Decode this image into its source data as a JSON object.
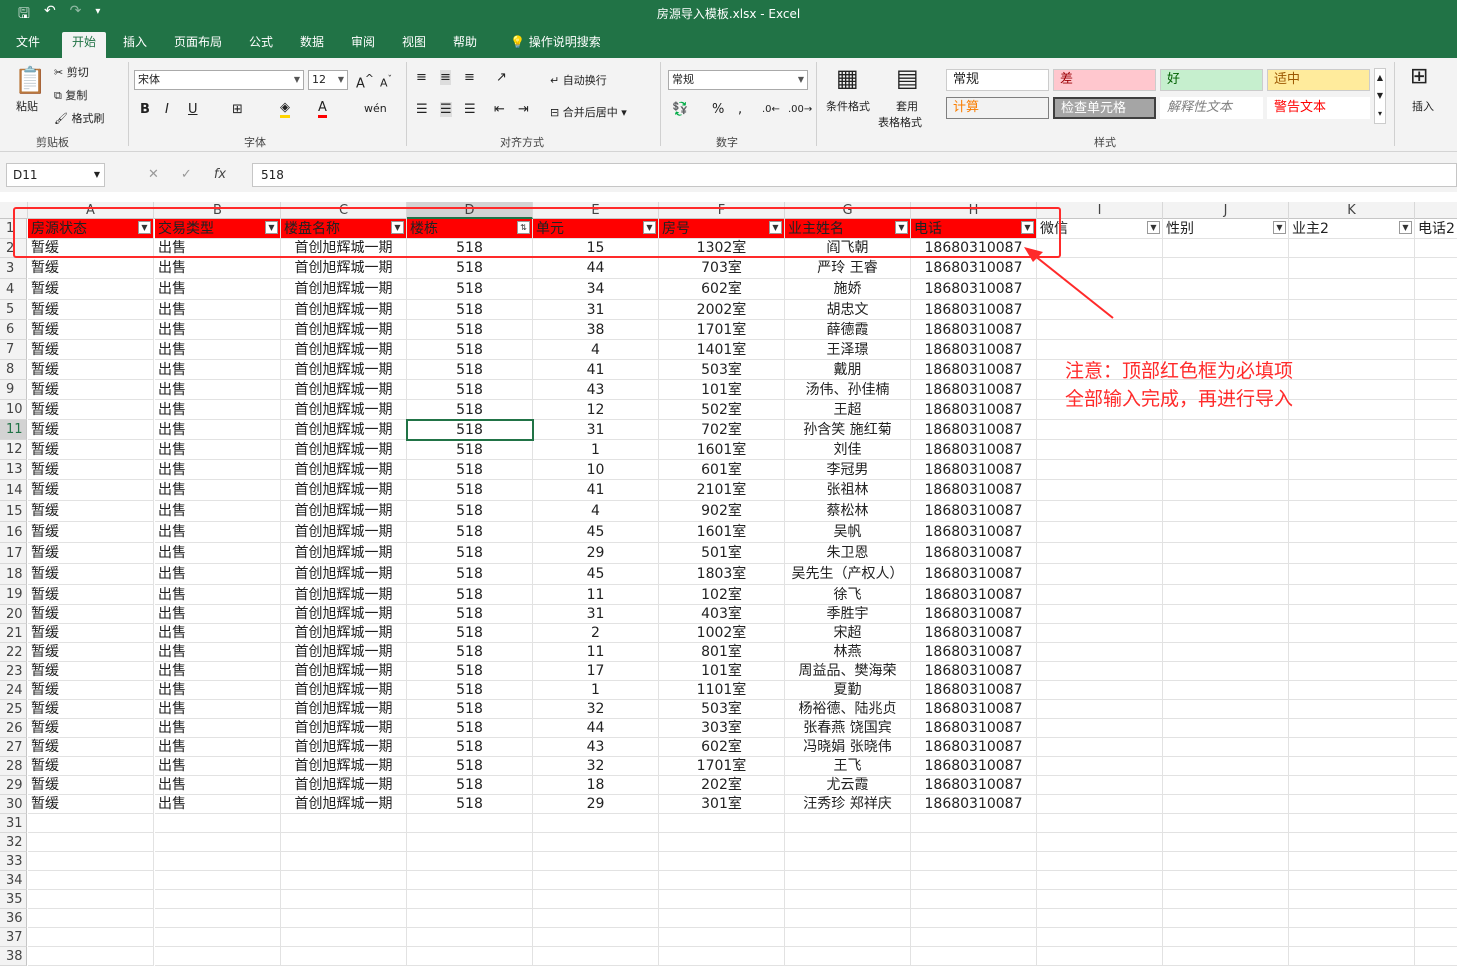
{
  "titlebar": {
    "title": "房源导入模板.xlsx  -  Excel"
  },
  "tabs": [
    "文件",
    "开始",
    "插入",
    "页面布局",
    "公式",
    "数据",
    "审阅",
    "视图",
    "帮助",
    "操作说明搜索"
  ],
  "ribbon": {
    "clipboard": {
      "paste": "粘贴",
      "cut": "剪切",
      "copy": "复制",
      "format_painter": "格式刷",
      "label": "剪贴板"
    },
    "font": {
      "name": "宋体",
      "size": "12",
      "label": "字体"
    },
    "alignment": {
      "wrap": "自动换行",
      "merge": "合并后居中",
      "label": "对齐方式"
    },
    "number": {
      "format": "常规",
      "label": "数字"
    },
    "styles": {
      "cond": "条件格式",
      "table1": "套用",
      "table2": "表格格式",
      "boxes": [
        "常规",
        "差",
        "好",
        "适中",
        "计算",
        "检查单元格",
        "解释性文本",
        "警告文本"
      ],
      "label": "样式"
    },
    "cells": {
      "insert": "插入"
    }
  },
  "formula": {
    "namebox": "D11",
    "value": "518"
  },
  "columns": [
    "A",
    "B",
    "C",
    "D",
    "E",
    "F",
    "G",
    "H",
    "I",
    "J",
    "K"
  ],
  "headers": [
    "房源状态",
    "交易类型",
    "楼盘名称",
    "楼栋",
    "单元",
    "房号",
    "业主姓名",
    "电话",
    "微信",
    "性别",
    "业主2",
    "电话2"
  ],
  "rows": [
    [
      "暂缓",
      "出售",
      "首创旭辉城一期",
      "518",
      "15",
      "1302室",
      "阎飞朝",
      "18680310087"
    ],
    [
      "暂缓",
      "出售",
      "首创旭辉城一期",
      "518",
      "44",
      "703室",
      "严玲 王睿",
      "18680310087"
    ],
    [
      "暂缓",
      "出售",
      "首创旭辉城一期",
      "518",
      "34",
      "602室",
      "施娇",
      "18680310087"
    ],
    [
      "暂缓",
      "出售",
      "首创旭辉城一期",
      "518",
      "31",
      "2002室",
      "胡忠文",
      "18680310087"
    ],
    [
      "暂缓",
      "出售",
      "首创旭辉城一期",
      "518",
      "38",
      "1701室",
      "薛德霞",
      "18680310087"
    ],
    [
      "暂缓",
      "出售",
      "首创旭辉城一期",
      "518",
      "4",
      "1401室",
      "王泽璟",
      "18680310087"
    ],
    [
      "暂缓",
      "出售",
      "首创旭辉城一期",
      "518",
      "41",
      "503室",
      "戴朋",
      "18680310087"
    ],
    [
      "暂缓",
      "出售",
      "首创旭辉城一期",
      "518",
      "43",
      "101室",
      "汤伟、孙佳楠",
      "18680310087"
    ],
    [
      "暂缓",
      "出售",
      "首创旭辉城一期",
      "518",
      "12",
      "502室",
      "王超",
      "18680310087"
    ],
    [
      "暂缓",
      "出售",
      "首创旭辉城一期",
      "518",
      "31",
      "702室",
      "孙含笑 施红菊",
      "18680310087"
    ],
    [
      "暂缓",
      "出售",
      "首创旭辉城一期",
      "518",
      "1",
      "1601室",
      "刘佳",
      "18680310087"
    ],
    [
      "暂缓",
      "出售",
      "首创旭辉城一期",
      "518",
      "10",
      "601室",
      "李冠男",
      "18680310087"
    ],
    [
      "暂缓",
      "出售",
      "首创旭辉城一期",
      "518",
      "41",
      "2101室",
      "张祖林",
      "18680310087"
    ],
    [
      "暂缓",
      "出售",
      "首创旭辉城一期",
      "518",
      "4",
      "902室",
      "蔡松林",
      "18680310087"
    ],
    [
      "暂缓",
      "出售",
      "首创旭辉城一期",
      "518",
      "45",
      "1601室",
      "吴帆",
      "18680310087"
    ],
    [
      "暂缓",
      "出售",
      "首创旭辉城一期",
      "518",
      "29",
      "501室",
      "朱卫恩",
      "18680310087"
    ],
    [
      "暂缓",
      "出售",
      "首创旭辉城一期",
      "518",
      "45",
      "1803室",
      "吴先生（产权人）",
      "18680310087"
    ],
    [
      "暂缓",
      "出售",
      "首创旭辉城一期",
      "518",
      "11",
      "102室",
      "徐飞",
      "18680310087"
    ],
    [
      "暂缓",
      "出售",
      "首创旭辉城一期",
      "518",
      "31",
      "403室",
      "季胜宇",
      "18680310087"
    ],
    [
      "暂缓",
      "出售",
      "首创旭辉城一期",
      "518",
      "2",
      "1002室",
      "宋超",
      "18680310087"
    ],
    [
      "暂缓",
      "出售",
      "首创旭辉城一期",
      "518",
      "11",
      "801室",
      "林燕",
      "18680310087"
    ],
    [
      "暂缓",
      "出售",
      "首创旭辉城一期",
      "518",
      "17",
      "101室",
      "周益品、樊海荣",
      "18680310087"
    ],
    [
      "暂缓",
      "出售",
      "首创旭辉城一期",
      "518",
      "1",
      "1101室",
      "夏勤",
      "18680310087"
    ],
    [
      "暂缓",
      "出售",
      "首创旭辉城一期",
      "518",
      "32",
      "503室",
      "杨裕德、陆兆贞",
      "18680310087"
    ],
    [
      "暂缓",
      "出售",
      "首创旭辉城一期",
      "518",
      "44",
      "303室",
      "张春燕 饶国宾",
      "18680310087"
    ],
    [
      "暂缓",
      "出售",
      "首创旭辉城一期",
      "518",
      "43",
      "602室",
      "冯晓娟 张晓伟",
      "18680310087"
    ],
    [
      "暂缓",
      "出售",
      "首创旭辉城一期",
      "518",
      "32",
      "1701室",
      "王飞",
      "18680310087"
    ],
    [
      "暂缓",
      "出售",
      "首创旭辉城一期",
      "518",
      "18",
      "202室",
      "尤云霞",
      "18680310087"
    ],
    [
      "暂缓",
      "出售",
      "首创旭辉城一期",
      "518",
      "29",
      "301室",
      "汪秀珍 郑祥庆",
      "18680310087"
    ]
  ],
  "row_numbers": [
    "1",
    "2",
    "3",
    "4",
    "5",
    "6",
    "7",
    "8",
    "9",
    "10",
    "11",
    "12",
    "13",
    "14",
    "15",
    "16",
    "17",
    "18",
    "19",
    "20",
    "21",
    "22",
    "23",
    "24",
    "25",
    "26",
    "27",
    "28",
    "29",
    "30",
    "31",
    "32",
    "33",
    "34",
    "35",
    "36",
    "37",
    "38"
  ],
  "note": {
    "line1": "注意：顶部红色框为必填项",
    "line2": "全部输入完成，再进行导入"
  }
}
